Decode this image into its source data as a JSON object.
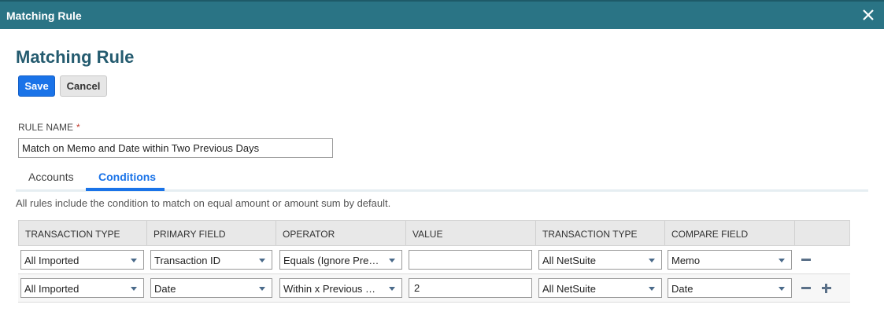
{
  "window": {
    "title": "Matching Rule",
    "close_icon": "close-icon"
  },
  "page": {
    "title": "Matching Rule"
  },
  "toolbar": {
    "save_label": "Save",
    "cancel_label": "Cancel"
  },
  "rule_name": {
    "label": "RULE NAME",
    "required_marker": "*",
    "value": "Match on Memo and Date within Two Previous Days"
  },
  "tabs": [
    {
      "label": "Accounts",
      "active": false
    },
    {
      "label": "Conditions",
      "active": true
    }
  ],
  "info_text": "All rules include the condition to match on equal amount or amount sum by default.",
  "grid": {
    "columns": [
      "TRANSACTION TYPE",
      "PRIMARY FIELD",
      "OPERATOR",
      "VALUE",
      "TRANSACTION TYPE",
      "COMPARE FIELD"
    ],
    "rows": [
      {
        "transaction_type": "All Imported",
        "primary_field": "Transaction ID",
        "operator": "Equals (Ignore Pre…",
        "value": "",
        "compare_transaction_type": "All NetSuite",
        "compare_field": "Memo",
        "actions": [
          "remove"
        ]
      },
      {
        "transaction_type": "All Imported",
        "primary_field": "Date",
        "operator": "Within x Previous …",
        "value": "2",
        "compare_transaction_type": "All NetSuite",
        "compare_field": "Date",
        "actions": [
          "remove",
          "add"
        ]
      }
    ]
  },
  "colors": {
    "titlebar": "#2a7485",
    "page_title": "#245b6f",
    "accent": "#1a73e8"
  }
}
